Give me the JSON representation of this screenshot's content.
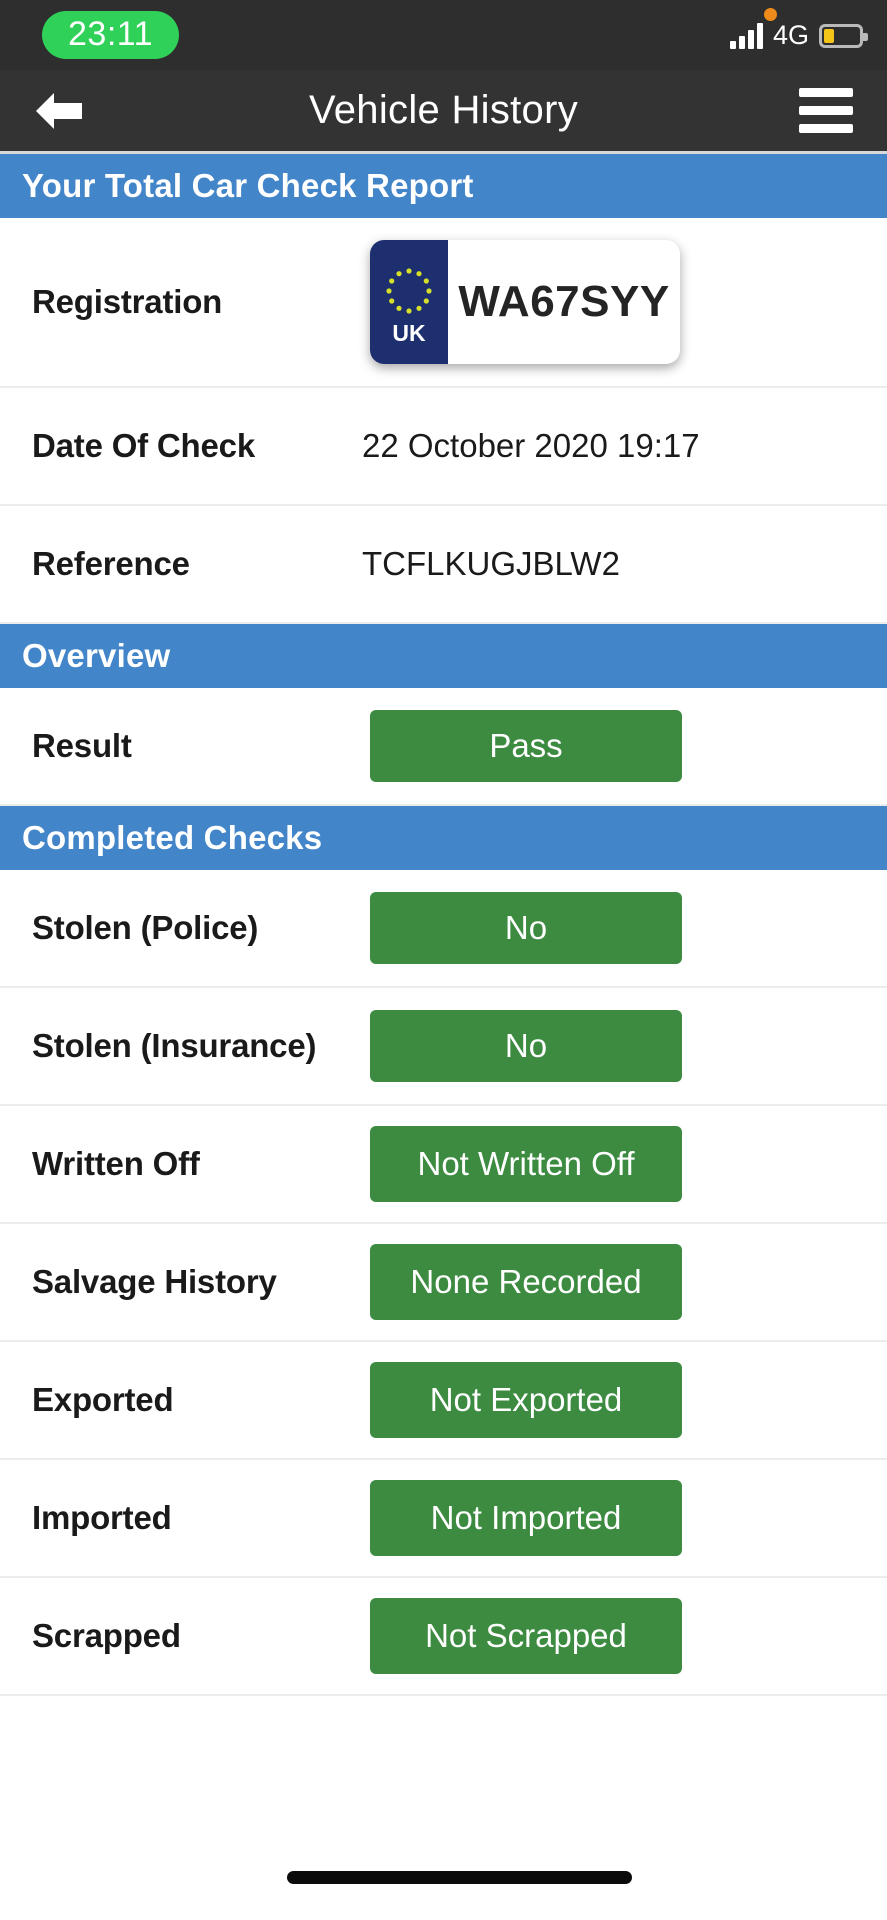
{
  "status_bar": {
    "time": "23:11",
    "network": "4G",
    "signal_icon": "signal-bars-icon",
    "battery_icon": "battery-low-icon",
    "recording_icon": "recording-dot-icon"
  },
  "nav": {
    "back_icon": "back-arrow-icon",
    "title": "Vehicle History",
    "menu_icon": "hamburger-menu-icon"
  },
  "report": {
    "header": "Your Total Car Check Report",
    "rows": [
      {
        "label": "Registration",
        "value": "WA67SYY",
        "type": "plate",
        "plate_country": "UK"
      },
      {
        "label": "Date Of Check",
        "value": "22 October 2020 19:17",
        "type": "text"
      },
      {
        "label": "Reference",
        "value": "TCFLKUGJBLW2",
        "type": "text"
      }
    ]
  },
  "overview": {
    "header": "Overview",
    "rows": [
      {
        "label": "Result",
        "value": "Pass",
        "type": "badge"
      }
    ]
  },
  "completed_checks": {
    "header": "Completed Checks",
    "rows": [
      {
        "label": "Stolen (Police)",
        "value": "No",
        "type": "badge"
      },
      {
        "label": "Stolen (Insurance)",
        "value": "No",
        "type": "badge"
      },
      {
        "label": "Written Off",
        "value": "Not Written Off",
        "type": "badge"
      },
      {
        "label": "Salvage History",
        "value": "None Recorded",
        "type": "badge"
      },
      {
        "label": "Exported",
        "value": "Not Exported",
        "type": "badge"
      },
      {
        "label": "Imported",
        "value": "Not Imported",
        "type": "badge"
      },
      {
        "label": "Scrapped",
        "value": "Not Scrapped",
        "type": "badge"
      }
    ]
  },
  "colors": {
    "accent_blue": "#4285c8",
    "status_green": "#3c8b40",
    "nav_dark": "#333333",
    "time_pill_green": "#30d158",
    "plate_navy": "#1d2f6f",
    "battery_yellow": "#f5c518"
  }
}
